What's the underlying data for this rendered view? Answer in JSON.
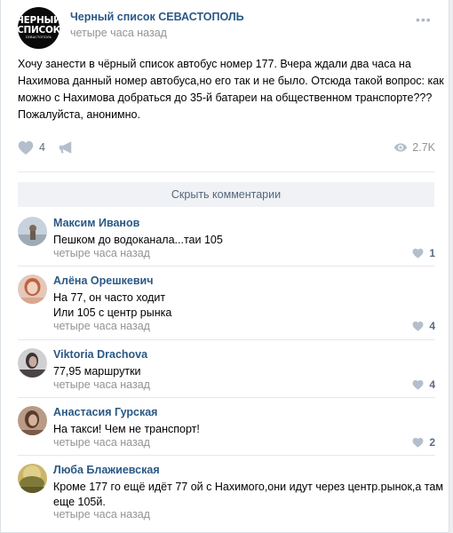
{
  "post": {
    "group_name": "Черный список СЕВАСТОПОЛЬ",
    "time": "четыре часа назад",
    "avatar_text": [
      "ЧЕРНЫЙ",
      "СПИСОК",
      "СЕВАСТОПОЛЬ"
    ],
    "more_icon": "more-dots-icon",
    "text_lines": [
      "Хочу занести в чёрный список автобус номер 177. Вчера ждали два часа на",
      "Нахимова данный номер автобуса,но его так и не было. Отсюда такой вопрос: как",
      "можно с Нахимова добраться до 35-й батареи на общественном транспорте???",
      "Пожалуйста, анонимно."
    ],
    "likes": "4",
    "views": "2.7K"
  },
  "hide_comments_label": "Скрыть комментарии",
  "comments": [
    {
      "author": "Максим Иванов",
      "lines": [
        "Пешком до водоканала...таи 105"
      ],
      "time": "четыре часа назад",
      "likes": "1",
      "avatar_color": "#a9b7c4"
    },
    {
      "author": "Алёна Орешкевич",
      "lines": [
        "На 77, он часто ходит",
        "Или 105 с центр рынка"
      ],
      "time": "четыре часа назад",
      "likes": "4",
      "avatar_color": "#c9907b"
    },
    {
      "author": "Viktoria Drachova",
      "lines": [
        "77,95 маршрутки"
      ],
      "time": "четыре часа назад",
      "likes": "4",
      "avatar_color": "#6f6a6c"
    },
    {
      "author": "Анастасия Гурская",
      "lines": [
        "На такси! Чем не транспорт!"
      ],
      "time": "четыре часа назад",
      "likes": "2",
      "avatar_color": "#8a6a58"
    },
    {
      "author": "Люба Блажиевская",
      "lines": [
        "Кроме 177 го ещё идёт 77 ой с Нахимого,они идут через центр.рынок,а там",
        "еще 105й."
      ],
      "time": "четыре часа назад",
      "likes": "",
      "avatar_color": "#b8a25a"
    }
  ],
  "colors": {
    "link": "#2a5885",
    "muted": "#939393",
    "icon": "#aeb7c2"
  }
}
